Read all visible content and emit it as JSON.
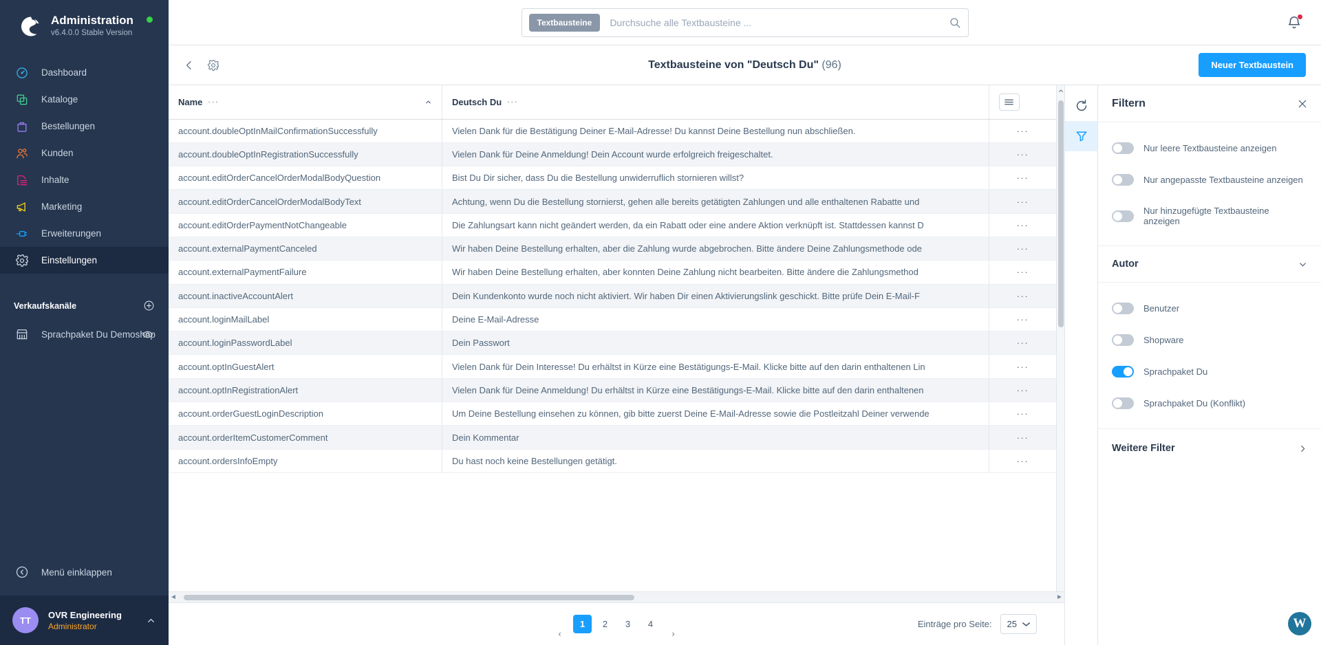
{
  "sidebar": {
    "brand": {
      "title": "Administration",
      "version": "v6.4.0.0 Stable Version"
    },
    "nav": [
      {
        "label": "Dashboard",
        "icon": "gauge-icon",
        "color": "#37aee5",
        "active": false
      },
      {
        "label": "Kataloge",
        "icon": "catalog-icon",
        "color": "#3ecf8e",
        "active": false
      },
      {
        "label": "Bestellungen",
        "icon": "bag-icon",
        "color": "#9a7cf5",
        "active": false
      },
      {
        "label": "Kunden",
        "icon": "users-icon",
        "color": "#f2762e",
        "active": false
      },
      {
        "label": "Inhalte",
        "icon": "content-icon",
        "color": "#ed1e79",
        "active": false
      },
      {
        "label": "Marketing",
        "icon": "megaphone-icon",
        "color": "#f5d313",
        "active": false
      },
      {
        "label": "Erweiterungen",
        "icon": "plug-icon",
        "color": "#189eff",
        "active": false
      },
      {
        "label": "Einstellungen",
        "icon": "gear-icon",
        "color": "#c7d0da",
        "active": true
      }
    ],
    "sales_channels_title": "Verkaufskanäle",
    "channels": [
      {
        "label": "Sprachpaket Du Demoshop",
        "icon": "store-icon"
      }
    ],
    "collapse_label": "Menü einklappen",
    "user": {
      "initials": "TT",
      "name": "OVR Engineering",
      "role": "Administrator"
    }
  },
  "topbar": {
    "search_scope": "Textbausteine",
    "search_placeholder": "Durchsuche alle Textbausteine ...",
    "search_value": ""
  },
  "pagehead": {
    "title": "Textbausteine von \"Deutsch Du\"",
    "count": "(96)",
    "primary_button": "Neuer Textbaustein"
  },
  "grid": {
    "columns": [
      {
        "label": "Name"
      },
      {
        "label": "Deutsch Du"
      }
    ],
    "sort_direction": "asc",
    "action_menu_label": "···",
    "rows": [
      {
        "name": "account.doubleOptInMailConfirmationSuccessfully",
        "value": "Vielen Dank für die Bestätigung Deiner E-Mail-Adresse! Du kannst Deine Bestellung nun abschließen."
      },
      {
        "name": "account.doubleOptInRegistrationSuccessfully",
        "value": "Vielen Dank für Deine Anmeldung! Dein Account wurde erfolgreich freigeschaltet."
      },
      {
        "name": "account.editOrderCancelOrderModalBodyQuestion",
        "value": "Bist Du Dir sicher, dass Du die Bestellung unwiderruflich stornieren willst?"
      },
      {
        "name": "account.editOrderCancelOrderModalBodyText",
        "value": "Achtung, wenn Du die Bestellung stornierst, gehen alle bereits getätigten Zahlungen und alle enthaltenen Rabatte und"
      },
      {
        "name": "account.editOrderPaymentNotChangeable",
        "value": "Die Zahlungsart kann nicht geändert werden, da ein Rabatt oder eine andere Aktion verknüpft ist. Stattdessen kannst D"
      },
      {
        "name": "account.externalPaymentCanceled",
        "value": "Wir haben Deine Bestellung erhalten, aber die Zahlung wurde abgebrochen. Bitte ändere Deine Zahlungsmethode ode"
      },
      {
        "name": "account.externalPaymentFailure",
        "value": "Wir haben Deine Bestellung erhalten, aber konnten Deine Zahlung nicht bearbeiten. Bitte ändere die Zahlungsmethod"
      },
      {
        "name": "account.inactiveAccountAlert",
        "value": "Dein Kundenkonto wurde noch nicht aktiviert. Wir haben Dir einen Aktivierungslink geschickt. Bitte prüfe Dein E-Mail-F"
      },
      {
        "name": "account.loginMailLabel",
        "value": "Deine E-Mail-Adresse"
      },
      {
        "name": "account.loginPasswordLabel",
        "value": "Dein Passwort"
      },
      {
        "name": "account.optInGuestAlert",
        "value": "Vielen Dank für Dein Interesse! Du erhältst in Kürze eine Bestätigungs-E-Mail. Klicke bitte auf den darin enthaltenen Lin"
      },
      {
        "name": "account.optInRegistrationAlert",
        "value": "Vielen Dank für Deine Anmeldung! Du erhältst in Kürze eine Bestätigungs-E-Mail. Klicke bitte auf den darin enthaltenen"
      },
      {
        "name": "account.orderGuestLoginDescription",
        "value": "Um Deine Bestellung einsehen zu können, gib bitte zuerst Deine E-Mail-Adresse sowie die Postleitzahl Deiner verwende"
      },
      {
        "name": "account.orderItemCustomerComment",
        "value": "Dein Kommentar"
      },
      {
        "name": "account.ordersInfoEmpty",
        "value": "Du hast noch keine Bestellungen getätigt."
      }
    ]
  },
  "footer": {
    "prev_label": "‹",
    "next_label": "›",
    "pages": [
      "1",
      "2",
      "3",
      "4"
    ],
    "current_page": "1",
    "per_page_label": "Einträge pro Seite:",
    "per_page_value": "25"
  },
  "rail": {
    "refresh_label": "refresh-icon",
    "filter_label": "filter-icon"
  },
  "filters": {
    "title": "Filtern",
    "toggles": [
      {
        "label": "Nur leere Textbausteine anzeigen",
        "on": false
      },
      {
        "label": "Nur angepasste Textbausteine anzeigen",
        "on": false
      },
      {
        "label": "Nur hinzugefügte Textbausteine anzeigen",
        "on": false
      }
    ],
    "author_group": "Autor",
    "author_toggles": [
      {
        "label": "Benutzer",
        "on": false
      },
      {
        "label": "Shopware",
        "on": false
      },
      {
        "label": "Sprachpaket Du",
        "on": true
      },
      {
        "label": "Sprachpaket Du (Konflikt)",
        "on": false
      }
    ],
    "more_filters": "Weitere Filter"
  },
  "colors": {
    "accent": "#189eff",
    "sidebar_bg": "#26364f",
    "active_bg": "#1c2a42"
  }
}
